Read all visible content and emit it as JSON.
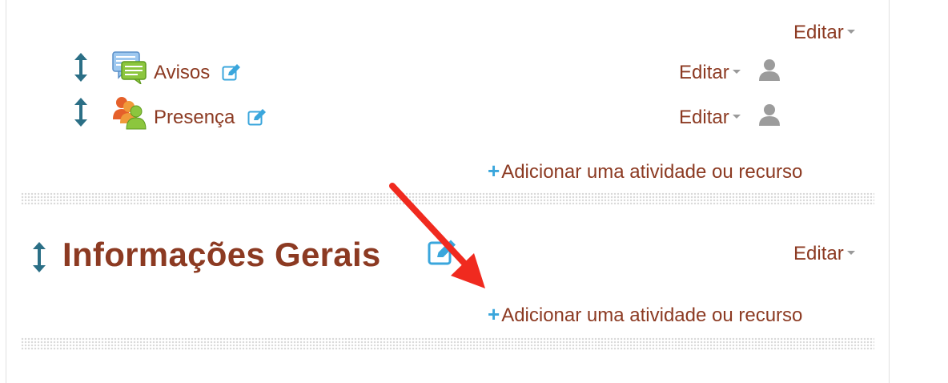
{
  "section_top": {
    "edit_menu_label": "Editar",
    "activities": [
      {
        "name": "Avisos",
        "icon": "forum-icon",
        "edit_menu_label": "Editar"
      },
      {
        "name": "Presença",
        "icon": "attendance-icon",
        "edit_menu_label": "Editar"
      }
    ],
    "add_activity_label": "Adicionar uma atividade ou recurso"
  },
  "section_general": {
    "title": "Informações Gerais",
    "edit_menu_label": "Editar",
    "add_activity_label": "Adicionar uma atividade ou recurso"
  },
  "colors": {
    "link": "#8c3a22",
    "accent_blue": "#3aa6dc",
    "move_icon": "#2b6f86",
    "annotation_arrow": "#f02a1f"
  }
}
